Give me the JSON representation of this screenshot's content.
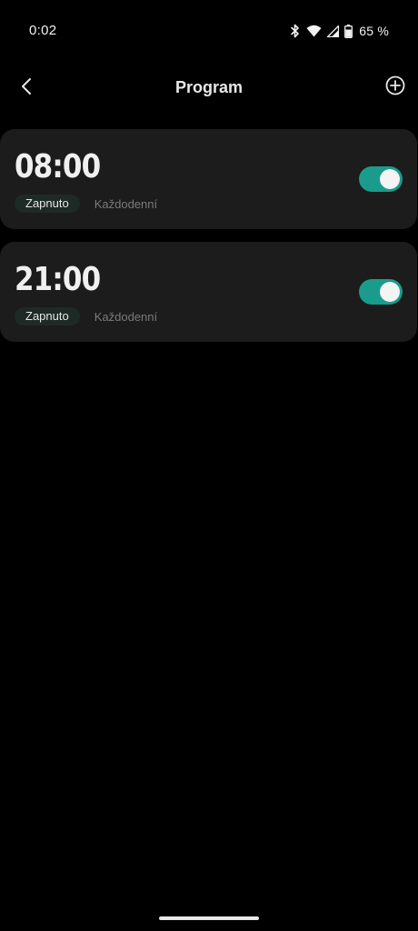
{
  "status_bar": {
    "time": "0:02",
    "battery_text": "65 %",
    "icons": [
      "bluetooth-icon",
      "wifi-icon",
      "signal-icon",
      "battery-icon"
    ]
  },
  "header": {
    "title": "Program",
    "back_icon": "chevron-left-icon",
    "add_icon": "plus-circle-icon"
  },
  "schedules": [
    {
      "time": "08:00",
      "status": "Zapnuto",
      "repeat": "Každodenní",
      "enabled": true
    },
    {
      "time": "21:00",
      "status": "Zapnuto",
      "repeat": "Každodenní",
      "enabled": true
    }
  ],
  "colors": {
    "background": "#000000",
    "card": "#1c1c1c",
    "accent": "#1a9c8c",
    "badge_bg": "#1e2a26",
    "muted_text": "#7a7a7a"
  }
}
